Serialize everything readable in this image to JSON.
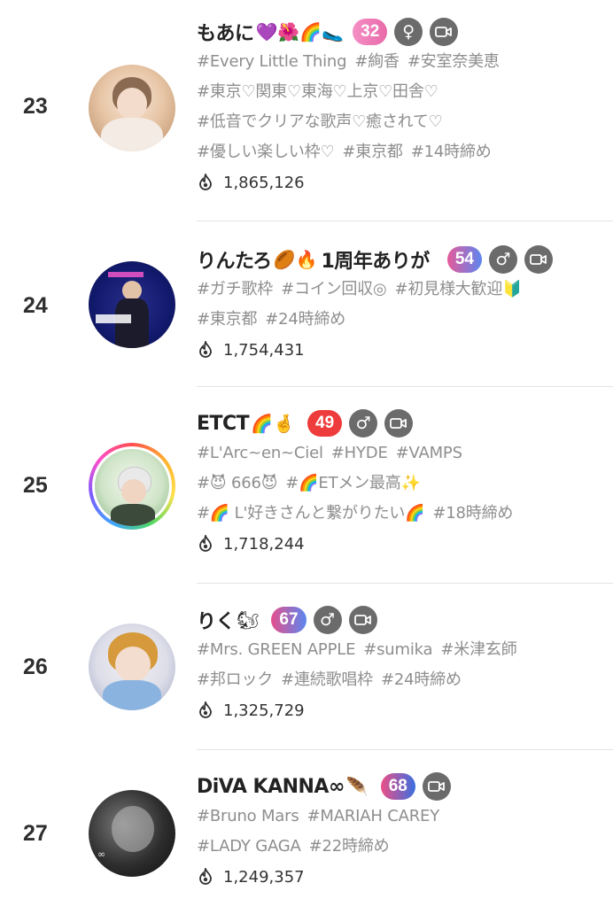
{
  "colors": {
    "rank_text": "#2f2f2f",
    "tag_text": "#8e8e8e",
    "icon_bg": "#6b6b6b",
    "level_23": "#f07ab8",
    "level_24": "#6a8ff0",
    "level_25": "#ee3b3b",
    "level_26": "#c86ad8",
    "level_27": "#3a6fe0"
  },
  "rows": [
    {
      "rank": "23",
      "name": "もあに",
      "name_emoji": "💜🌺🌈🥿",
      "level": "32",
      "gender_icon": "female-icon",
      "gender_glyph": "♀",
      "tags": [
        "#Every Little Thing",
        "#絢香",
        "#安室奈美恵",
        "#東京♡関東♡東海♡上京♡田舎♡",
        "#低音でクリアな歌声♡癒されて♡",
        "#優しい楽しい枠♡",
        "#東京都",
        "#14時締め"
      ],
      "score": "1,865,126"
    },
    {
      "rank": "24",
      "name": "りんたろ",
      "name_emoji": "🏉🔥",
      "name_suffix": "1周年ありが",
      "level": "54",
      "gender_icon": "male-icon",
      "gender_glyph": "♂",
      "tags": [
        "#ガチ歌枠",
        "#コイン回収◎",
        "#初見様大歓迎🔰",
        "#東京都",
        "#24時締め"
      ],
      "score": "1,754,431"
    },
    {
      "rank": "25",
      "name": "ETCT",
      "name_emoji": "🌈🤞",
      "level": "49",
      "gender_icon": "male-icon",
      "gender_glyph": "♂",
      "tags": [
        "#L'Arc~en~Ciel",
        "#HYDE",
        "#VAMPS",
        "#😈 666😈",
        "#🌈ETメン最高✨",
        "#🌈 L'好きさんと繋がりたい🌈",
        "#18時締め"
      ],
      "score": "1,718,244"
    },
    {
      "rank": "26",
      "name": "りく",
      "name_emoji": "🐿",
      "level": "67",
      "gender_icon": "male-icon",
      "gender_glyph": "♂",
      "tags": [
        "#Mrs. GREEN APPLE",
        "#sumika",
        "#米津玄師",
        "#邦ロック",
        "#連続歌唱枠",
        "#24時締め"
      ],
      "score": "1,325,729"
    },
    {
      "rank": "27",
      "name": "DiVA KANNA∞",
      "name_emoji": "🪶",
      "level": "68",
      "tags": [
        "#Bruno Mars",
        "#MARIAH CAREY",
        "#LADY GAGA",
        "#22時締め"
      ],
      "score": "1,249,357"
    }
  ]
}
